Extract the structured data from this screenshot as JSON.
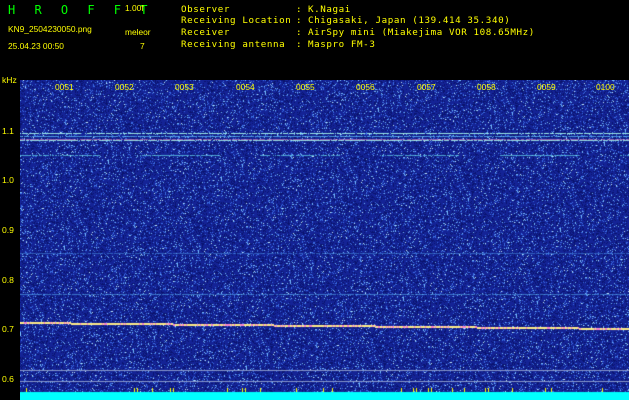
{
  "header": {
    "app_title": "H R O F F T",
    "version": "1.00f",
    "filename": "KN9_2504230050.png",
    "mode": "meleor",
    "timestamp": "25.04.23 00:50",
    "count": "7",
    "info": [
      {
        "label": "Observer",
        "value": "K.Nagai"
      },
      {
        "label": "Receiving Location",
        "value": "Chigasaki, Japan (139.414 35.340)"
      },
      {
        "label": "Receiver",
        "value": "AirSpy mini (Miakejima VOR 108.65MHz)"
      },
      {
        "label": "Receiving antenna",
        "value": "Maspro FM-3"
      }
    ]
  },
  "plot": {
    "y_unit": "kHz",
    "y_ticks": [
      "1.1",
      "1.0",
      "0.9",
      "0.8",
      "0.7",
      "0.6"
    ],
    "time_ticks": [
      "0051",
      "0052",
      "0053",
      "0054",
      "0055",
      "0056",
      "0057",
      "0058",
      "0059",
      "0100"
    ],
    "colors": {
      "background": "#1a2a9a",
      "label": "#ffff00",
      "trace_bright": "#aaffee",
      "trace_pink": "#ff88cc",
      "baseline": "#00ffff"
    }
  }
}
